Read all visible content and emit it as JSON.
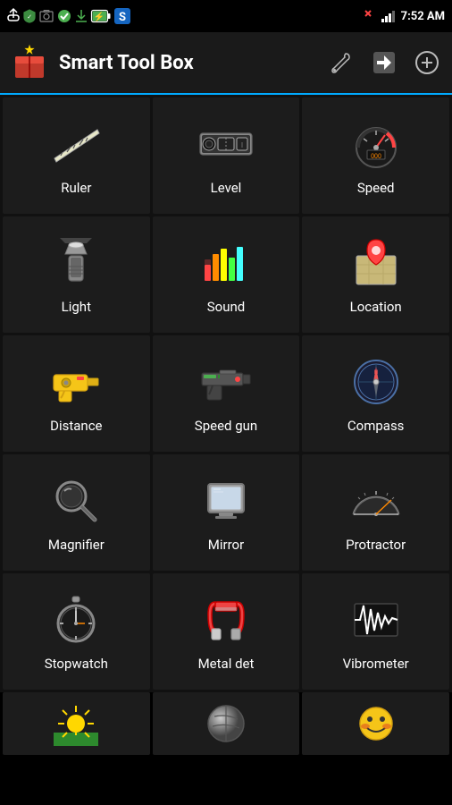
{
  "statusBar": {
    "time": "7:52 AM",
    "icons_left": [
      "usb",
      "shield",
      "photo",
      "check",
      "download",
      "battery-charging",
      "s-app"
    ],
    "signal": "signal",
    "battery": "100%"
  },
  "appBar": {
    "title": "Smart Tool Box"
  },
  "tools": [
    {
      "id": "ruler",
      "label": "Ruler"
    },
    {
      "id": "level",
      "label": "Level"
    },
    {
      "id": "speed",
      "label": "Speed"
    },
    {
      "id": "light",
      "label": "Light"
    },
    {
      "id": "sound",
      "label": "Sound"
    },
    {
      "id": "location",
      "label": "Location"
    },
    {
      "id": "distance",
      "label": "Distance"
    },
    {
      "id": "speed-gun",
      "label": "Speed gun"
    },
    {
      "id": "compass",
      "label": "Compass"
    },
    {
      "id": "magnifier",
      "label": "Magnifier"
    },
    {
      "id": "mirror",
      "label": "Mirror"
    },
    {
      "id": "protractor",
      "label": "Protractor"
    },
    {
      "id": "stopwatch",
      "label": "Stopwatch"
    },
    {
      "id": "metal-det",
      "label": "Metal det"
    },
    {
      "id": "vibrometer",
      "label": "Vibrometer"
    }
  ],
  "bottomRow": [
    {
      "id": "sun",
      "label": ""
    },
    {
      "id": "ball",
      "label": ""
    },
    {
      "id": "mask",
      "label": ""
    }
  ]
}
